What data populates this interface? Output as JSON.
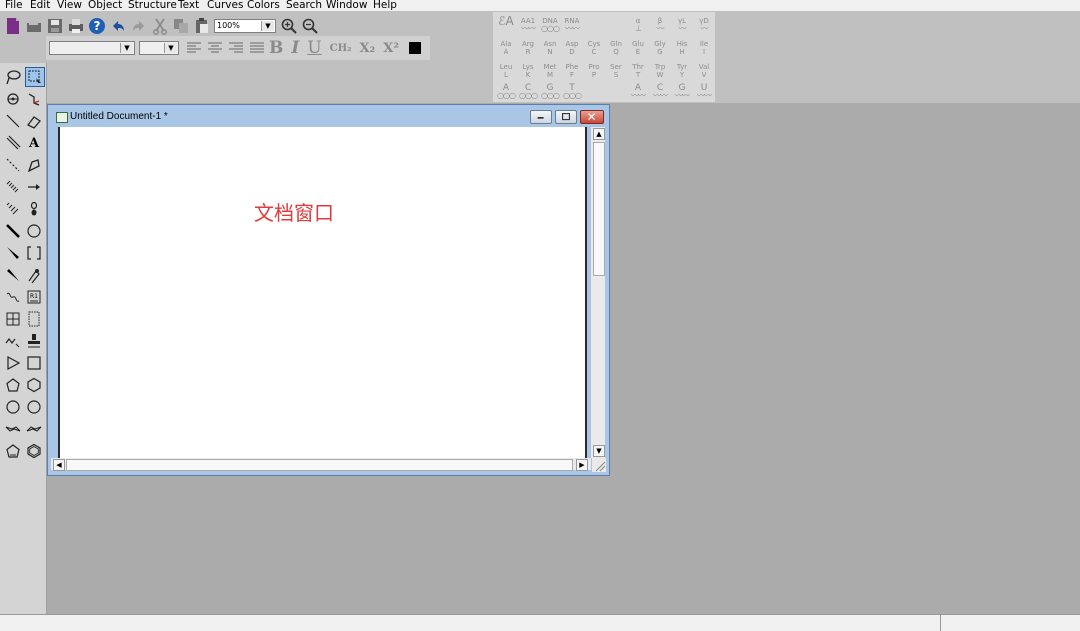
{
  "menu": {
    "items": [
      "File",
      "Edit",
      "View",
      "Object",
      "Structure",
      "Text",
      "Curves",
      "Colors",
      "Search",
      "Window",
      "Help"
    ]
  },
  "toolbar": {
    "zoom_value": "100%",
    "format_buttons": {
      "bold": "B",
      "italic": "I",
      "underline": "U",
      "ch2": "CH₂",
      "subscript": "X₂",
      "superscript": "X²"
    }
  },
  "amino_acid_panel": {
    "row1": [
      "AA1",
      "DNA",
      "RNA"
    ],
    "row1_right": [
      "α",
      "β",
      "γL",
      "γD"
    ],
    "row2": [
      [
        "Ala",
        "A"
      ],
      [
        "Arg",
        "R"
      ],
      [
        "Asn",
        "N"
      ],
      [
        "Asp",
        "D"
      ],
      [
        "Cys",
        "C"
      ],
      [
        "Gln",
        "Q"
      ],
      [
        "Glu",
        "E"
      ],
      [
        "Gly",
        "G"
      ],
      [
        "His",
        "H"
      ],
      [
        "Ile",
        "I"
      ]
    ],
    "row3": [
      [
        "Leu",
        "L"
      ],
      [
        "Lys",
        "K"
      ],
      [
        "Met",
        "M"
      ],
      [
        "Phe",
        "F"
      ],
      [
        "Pro",
        "P"
      ],
      [
        "Ser",
        "S"
      ],
      [
        "Thr",
        "T"
      ],
      [
        "Trp",
        "W"
      ],
      [
        "Tyr",
        "Y"
      ],
      [
        "Val",
        "V"
      ]
    ],
    "row4_left": [
      "A",
      "C",
      "G",
      "T"
    ],
    "row4_right": [
      "A",
      "C",
      "G",
      "U"
    ]
  },
  "document_window": {
    "title": "Untitled Document-1 *",
    "canvas_label": "文档窗口"
  },
  "colors": {
    "canvas_label": "#e03a3a",
    "window_frame": "#a9c6e6",
    "close_button": "#c9473a"
  }
}
